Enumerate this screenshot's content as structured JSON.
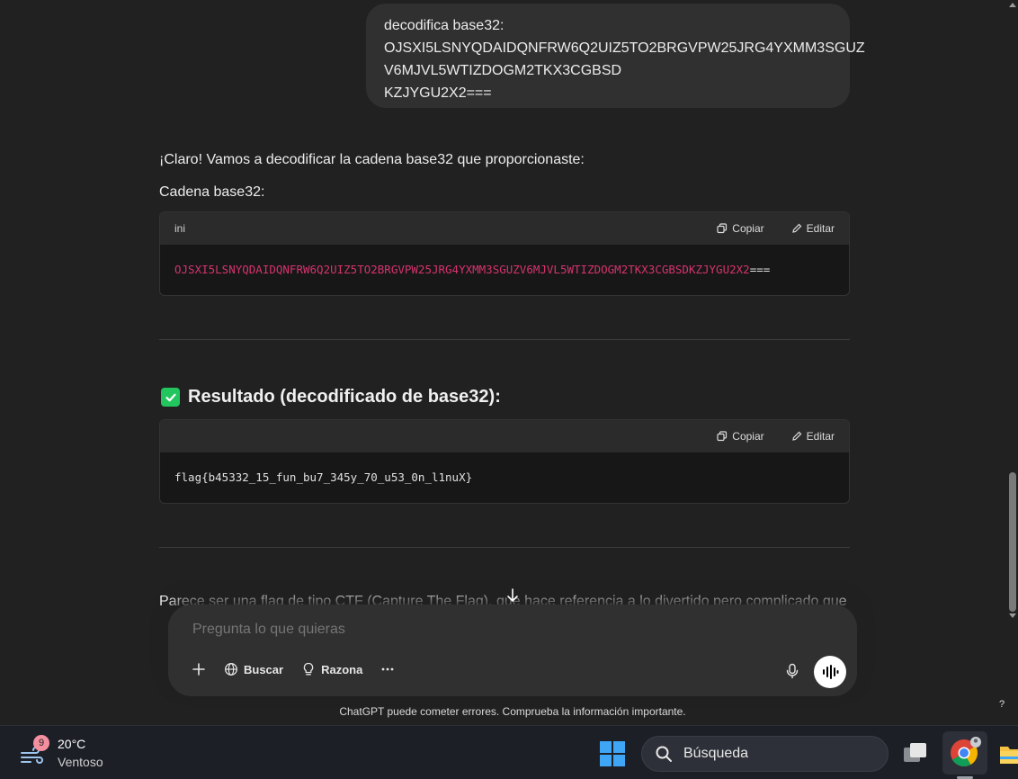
{
  "user_message": {
    "lines": [
      "decodifica base32:",
      "OJSXI5LSNYQDAIDQNFRW6Q2UIZ5TO2BRGVPW25JRG4YXMM3SGUZ",
      "V6MJVL5WTIZDOGM2TKX3CGBSD",
      "KZJYGU2X2==="
    ]
  },
  "assistant": {
    "intro": "¡Claro! Vamos a decodificar la cadena base32 que proporcionaste:",
    "input_label": "Cadena base32:",
    "code_block_1": {
      "language": "ini",
      "copy_label": "Copiar",
      "edit_label": "Editar",
      "code_value": "OJSXI5LSNYQDAIDQNFRW6Q2UIZ5TO2BRGVPW25JRG4YXMM3SGUZV6MJVL5WTIZDOGM2TKX3CGBSDKZJYGU2X2",
      "code_padding": "==="
    },
    "result_heading": "Resultado (decodificado de base32):",
    "code_block_2": {
      "copy_label": "Copiar",
      "edit_label": "Editar",
      "code": "flag{b45332_15_fun_bu7_345y_70_u53_0n_l1nuX}"
    },
    "trailing_text": "Parece ser una flag de tipo CTF (Capture The Flag), que hace referencia a lo divertido pero complicado que"
  },
  "composer": {
    "placeholder": "Pregunta lo que quieras",
    "tools": {
      "search_label": "Buscar",
      "reason_label": "Razona"
    }
  },
  "disclaimer": "ChatGPT puede cometer errores. Comprueba la información importante.",
  "help_label": "?",
  "taskbar": {
    "weather": {
      "badge": "9",
      "temperature": "20°C",
      "condition": "Ventoso"
    },
    "search_placeholder": "Búsqueda"
  },
  "colors": {
    "background": "#212121",
    "bubble": "#303030",
    "code_pink": "#d6336c",
    "check_green": "#22c55e"
  }
}
